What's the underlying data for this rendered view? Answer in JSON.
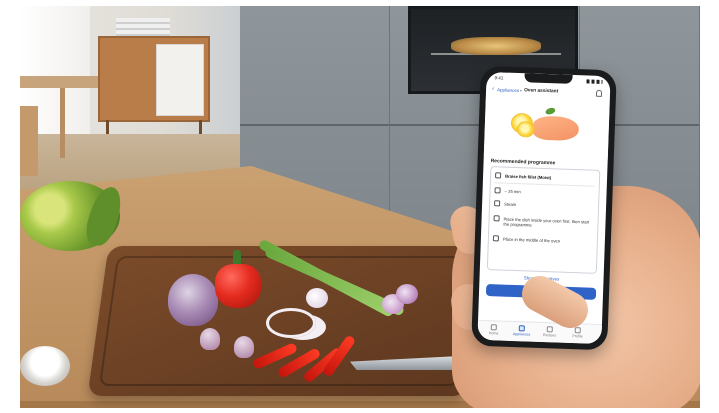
{
  "phone": {
    "status_time": "9:41",
    "header": {
      "back_label": "Appliances",
      "separator": "•",
      "title": "Oven assistant"
    },
    "section_title": "Recommended programme",
    "programme_card": {
      "title": "Braise fish fillet (Moist)",
      "rows": [
        {
          "icon": "timer-icon",
          "text": "~ 25 min"
        },
        {
          "icon": "steam-icon",
          "text": "Steam"
        },
        {
          "icon": "tray-icon",
          "text": "Place the dish inside your oven first, then start the programme"
        },
        {
          "icon": "shelf-icon",
          "text": "Place in the middle of the oven"
        }
      ]
    },
    "show_alternatives": "Show alternatives",
    "primary_button_label": "",
    "tabs": [
      {
        "label": "Home",
        "active": false
      },
      {
        "label": "Appliances",
        "active": true
      },
      {
        "label": "Recipes",
        "active": false
      },
      {
        "label": "Profile",
        "active": false
      }
    ]
  },
  "colors": {
    "accent": "#2f63c8",
    "cabinet": "#858c91",
    "countertop": "#c49868",
    "board": "#6a3f23",
    "pepper": "#e52b1f"
  }
}
